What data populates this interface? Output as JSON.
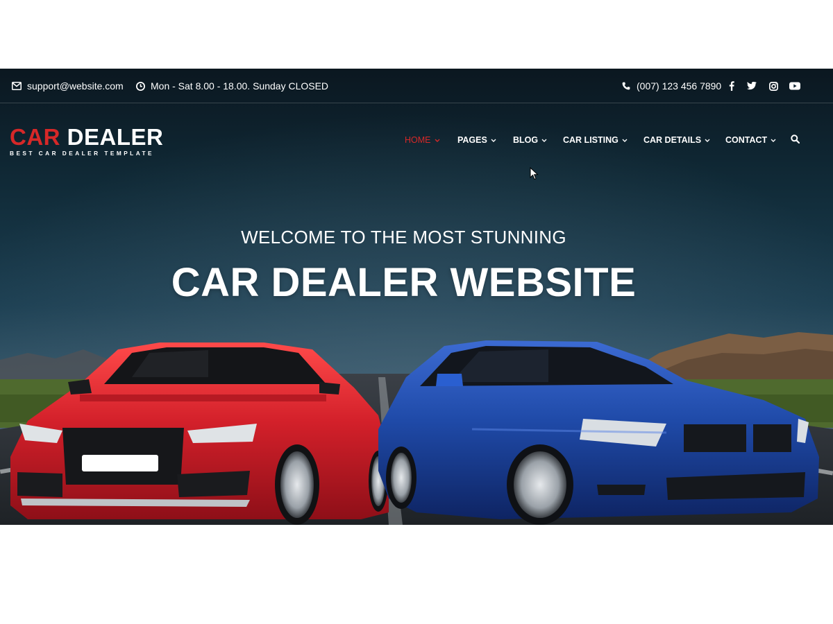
{
  "topbar": {
    "email": "support@website.com",
    "hours": "Mon - Sat 8.00 - 18.00. Sunday CLOSED",
    "phone": "(007) 123 456 7890",
    "icons": {
      "email": "envelope-icon",
      "hours": "clock-icon",
      "phone": "phone-icon",
      "social": [
        "facebook-icon",
        "twitter-icon",
        "instagram-icon",
        "youtube-icon"
      ]
    }
  },
  "brand": {
    "logo_red": "CAR",
    "logo_white": "DEALER",
    "tagline": "BEST CAR DEALER TEMPLATE"
  },
  "nav": {
    "items": [
      {
        "label": "HOME",
        "active": true
      },
      {
        "label": "PAGES",
        "active": false
      },
      {
        "label": "BLOG",
        "active": false
      },
      {
        "label": "CAR LISTING",
        "active": false
      },
      {
        "label": "CAR DETAILS",
        "active": false
      },
      {
        "label": "CONTACT",
        "active": false
      }
    ],
    "search_icon": "search-icon"
  },
  "hero": {
    "subtitle": "WELCOME TO THE MOST STUNNING",
    "title": "CAR DEALER WEBSITE"
  },
  "colors": {
    "accent": "#d62828",
    "text": "#ffffff",
    "red_car": "#d3202a",
    "blue_car": "#1f4aa8"
  }
}
